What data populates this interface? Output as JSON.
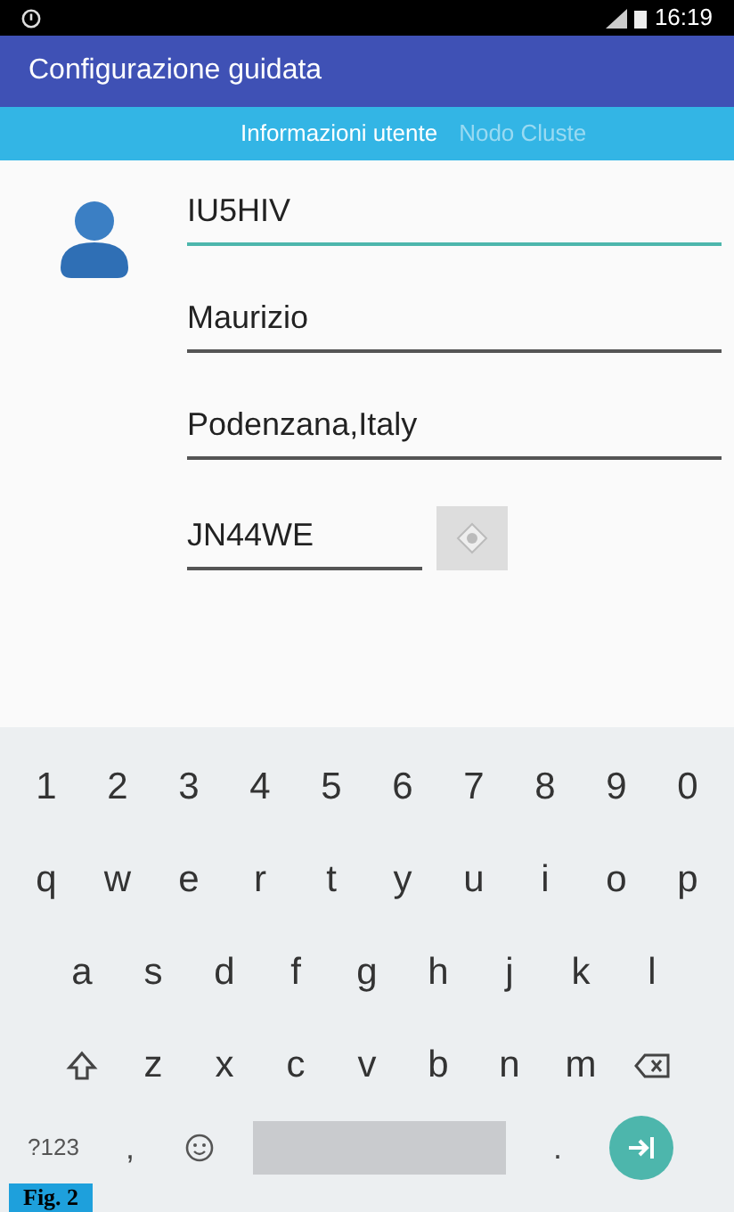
{
  "status_bar": {
    "time": "16:19"
  },
  "app_bar": {
    "title": "Configurazione guidata"
  },
  "tabs": [
    {
      "label": "Informazioni utente",
      "selected": true
    },
    {
      "label": "Nodo Cluste",
      "selected": false
    }
  ],
  "fields": [
    {
      "value": "IU5HIV",
      "focused": true,
      "kind": "text"
    },
    {
      "value": "Maurizio",
      "focused": false,
      "kind": "text"
    },
    {
      "value": "Podenzana,Italy",
      "focused": false,
      "kind": "text"
    },
    {
      "value": "JN44WE",
      "focused": false,
      "kind": "locator"
    }
  ],
  "keyboard": {
    "rows": [
      [
        "1",
        "2",
        "3",
        "4",
        "5",
        "6",
        "7",
        "8",
        "9",
        "0"
      ],
      [
        "q",
        "w",
        "e",
        "r",
        "t",
        "y",
        "u",
        "i",
        "o",
        "p"
      ],
      [
        "a",
        "s",
        "d",
        "f",
        "g",
        "h",
        "j",
        "k",
        "l"
      ],
      [
        "z",
        "x",
        "c",
        "v",
        "b",
        "n",
        "m"
      ]
    ],
    "symbols_key": "?123",
    "comma_key": ",",
    "period_key": "."
  },
  "figure_label": "Fig. 2"
}
